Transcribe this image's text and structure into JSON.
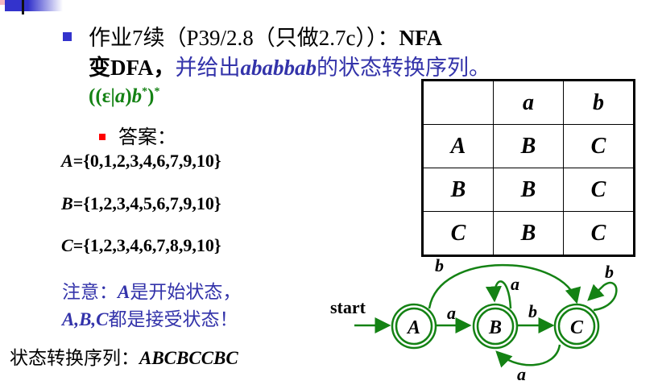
{
  "header": {
    "line1": {
      "prefix": "作业7续（P39/2.8（只做2.7c））：",
      "bold": "NFA"
    },
    "line2": {
      "bold_cn": "变",
      "bold": "DFA，",
      "blue_cn": "并给出",
      "blue_italic": "ababbab",
      "blue_tail": "的状态转换序列。"
    },
    "regex": "((ε|a)b*)*",
    "regex_parts": [
      "((ε|",
      "a",
      ")",
      "b",
      "*",
      ")",
      "*"
    ]
  },
  "answer": {
    "label": "答案：",
    "sets": [
      {
        "name": "A",
        "value": "={0,1,2,3,4,6,7,9,10}"
      },
      {
        "name": "B",
        "value": "={1,2,3,4,5,6,7,9,10}"
      },
      {
        "name": "C",
        "value": "={1,2,3,4,6,7,8,9,10}"
      }
    ],
    "note1": {
      "prefix": "注意：",
      "state": "A",
      "suffix": "是开始状态，"
    },
    "note2": {
      "states": "A,B,C",
      "suffix": "都是接受状态！"
    },
    "sequence_label": "状态转换序列：",
    "sequence": "ABCBCCBC"
  },
  "table": {
    "headers": [
      "",
      "a",
      "b"
    ],
    "rows": [
      [
        "A",
        "B",
        "C"
      ],
      [
        "B",
        "B",
        "C"
      ],
      [
        "C",
        "B",
        "C"
      ]
    ]
  },
  "diagram": {
    "start_label": "start",
    "states": [
      "A",
      "B",
      "C"
    ],
    "edges": [
      {
        "from": "A",
        "to": "B",
        "label": "a"
      },
      {
        "from": "A",
        "to": "C",
        "label": "b"
      },
      {
        "from": "B",
        "to": "B",
        "label": "a"
      },
      {
        "from": "B",
        "to": "C",
        "label": "b"
      },
      {
        "from": "C",
        "to": "C",
        "label": "b"
      },
      {
        "from": "C",
        "to": "B",
        "label": "a"
      }
    ],
    "color": "#148214"
  },
  "colors": {
    "bullet_main": "#3333cc",
    "bullet_sub": "#ff0000",
    "accent_blue": "#3333aa",
    "accent_green": "#148214"
  }
}
